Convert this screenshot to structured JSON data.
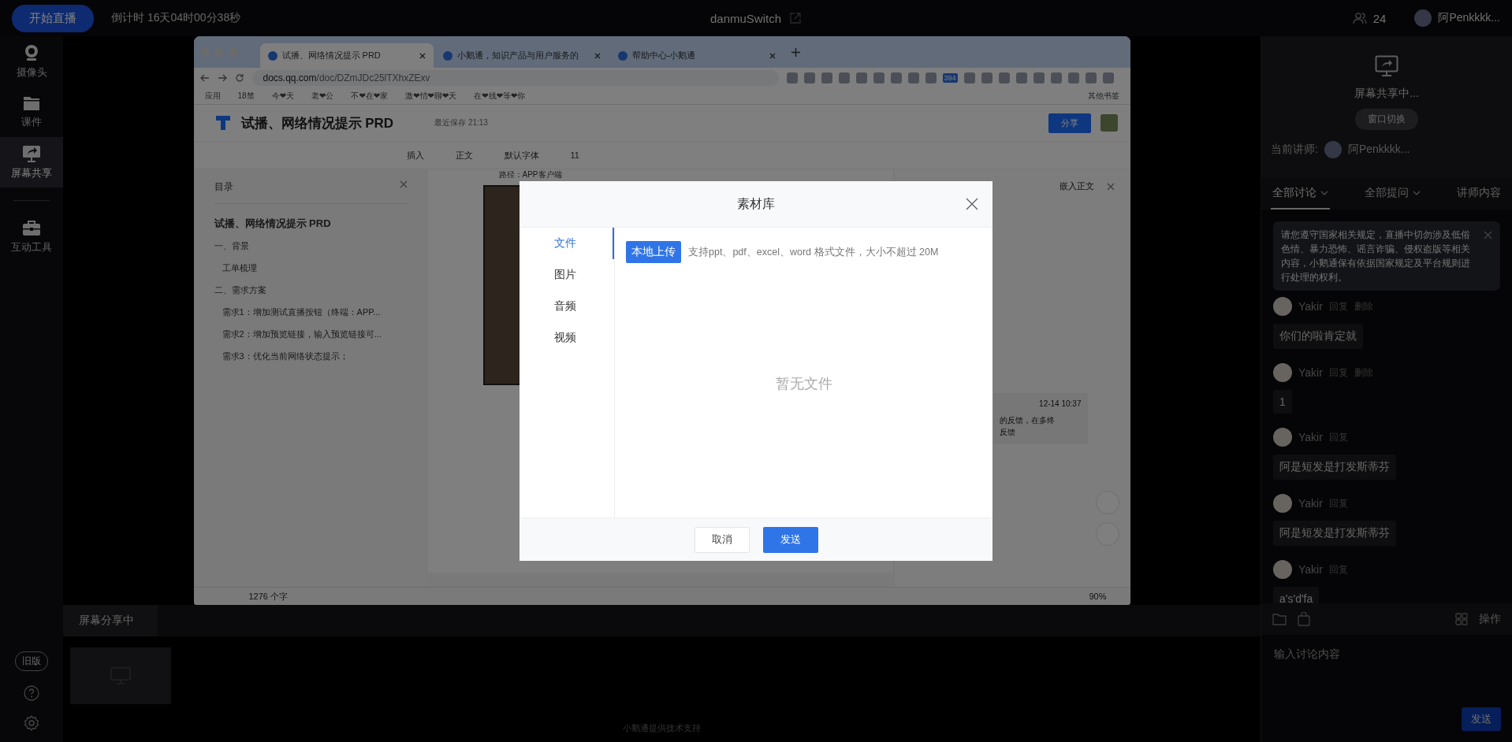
{
  "topbar": {
    "start_button": "开始直播",
    "countdown": "倒计时 16天04时00分38秒",
    "room_title": "danmuSwitch",
    "viewer_count": "24",
    "user_name": "阿Penkkkk..."
  },
  "sidebar": {
    "items": [
      {
        "label": "摄像头",
        "kind": "camera",
        "selected": false
      },
      {
        "label": "课件",
        "kind": "folder",
        "selected": false
      },
      {
        "label": "屏幕共享",
        "kind": "screen",
        "selected": true
      },
      {
        "label": "互动工具",
        "kind": "toolbox",
        "selected": false
      }
    ],
    "old_version_button": "旧版"
  },
  "browser": {
    "tabs": [
      {
        "title": "试播、网络情况提示 PRD",
        "selected": true
      },
      {
        "title": "小鹅通，知识产品与用户服务的",
        "selected": false
      },
      {
        "title": "帮助中心-小鹅通",
        "selected": false
      }
    ],
    "url_host": "docs.qq.com",
    "url_path": "/doc/DZmJDc25lTXhxZExv",
    "extension_badge": "394",
    "bookmarks": [
      "应用",
      "18禁",
      "今❤天",
      "老❤公",
      "不❤在❤家",
      "激❤情❤聊❤天",
      "在❤线❤等❤你"
    ],
    "other_bookmarks": "其他书签",
    "doc_title": "试播、网络情况提示 PRD",
    "save_status": "最近保存 21:13",
    "share_button": "分享",
    "toolbar": [
      "插入",
      "正文",
      "默认字体",
      "11"
    ],
    "outline": {
      "title": "目录",
      "heading": "试播、网络情况提示 PRD",
      "items": [
        {
          "text": "一、背景",
          "children": [
            {
              "text": "工单梳理"
            }
          ]
        },
        {
          "text": "二、需求方案",
          "children": [
            {
              "text": "需求1：增加测试直播按钮（终端：APP..."
            },
            {
              "text": "需求2：增加预览链接，输入预览链接可..."
            },
            {
              "text": "需求3：优化当前网络状态提示；"
            }
          ]
        }
      ]
    },
    "page_lines": [
      "路径：APP客户端"
    ],
    "comment_pane": {
      "embed_label": "嵌入正文",
      "comment_date": "12-14 10:37",
      "comment_lines": [
        "的反馈，在多终",
        "反馈"
      ]
    },
    "word_count": "1276 个字",
    "zoom": "90%"
  },
  "bottom": {
    "tab": "屏幕分享中",
    "credit": "小鹅通提供技术支持"
  },
  "right_panel": {
    "sharing_status": "屏幕共享中...",
    "switch_button": "窗口切换",
    "lecturer_label": "当前讲师:",
    "lecturer_name": "阿Penkkkk...",
    "tabs": [
      {
        "label": "全部讨论",
        "dropdown": true,
        "selected": true
      },
      {
        "label": "全部提问",
        "dropdown": true,
        "selected": false
      },
      {
        "label": "讲师内容",
        "dropdown": false,
        "selected": false
      }
    ],
    "notice": "请您遵守国家相关规定，直播中切勿涉及低俗色情、暴力恐怖、谣言诈骗、侵权盗版等相关内容，小鹅通保有依据国家规定及平台规则进行处理的权利。",
    "messages": [
      {
        "author": "Yakir",
        "actions": [
          "回复",
          "删除"
        ],
        "text": "你们的啦肯定就"
      },
      {
        "author": "Yakir",
        "actions": [
          "回复",
          "删除"
        ],
        "text": "1"
      },
      {
        "author": "Yakir",
        "actions": [
          "回复"
        ],
        "text": "阿是短发是打发斯蒂芬"
      },
      {
        "author": "Yakir",
        "actions": [
          "回复"
        ],
        "text": "阿是短发是打发斯蒂芬"
      },
      {
        "author": "Yakir",
        "actions": [
          "回复"
        ],
        "text": "a's'd'fa"
      }
    ],
    "actions_label": "操作",
    "input": {
      "placeholder": "输入讨论内容"
    },
    "send_button": "发送"
  },
  "modal": {
    "title": "素材库",
    "nav": [
      {
        "label": "文件",
        "selected": true
      },
      {
        "label": "图片",
        "selected": false
      },
      {
        "label": "音频",
        "selected": false
      },
      {
        "label": "视频",
        "selected": false
      }
    ],
    "upload_button": "本地上传",
    "hint": "支持ppt、pdf、excel、word 格式文件，大小不超过 20M",
    "empty": "暂无文件",
    "cancel_button": "取消",
    "confirm_button": "发送"
  }
}
